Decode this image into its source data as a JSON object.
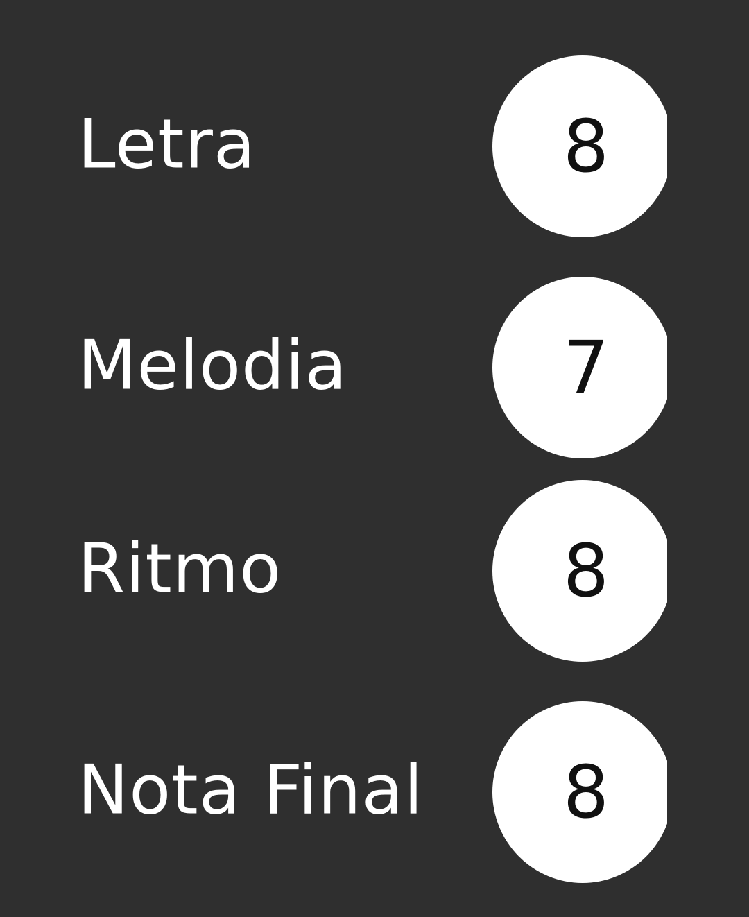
{
  "ratings": [
    {
      "label": "Letra",
      "score": "8"
    },
    {
      "label": "Melodia",
      "score": "7"
    },
    {
      "label": "Ritmo",
      "score": "8"
    },
    {
      "label": "Nota Final",
      "score": "8"
    }
  ],
  "colors": {
    "background": "#2f2f2f",
    "label_text": "#ffffff",
    "badge_fill": "#ffffff",
    "badge_text": "#111111"
  }
}
